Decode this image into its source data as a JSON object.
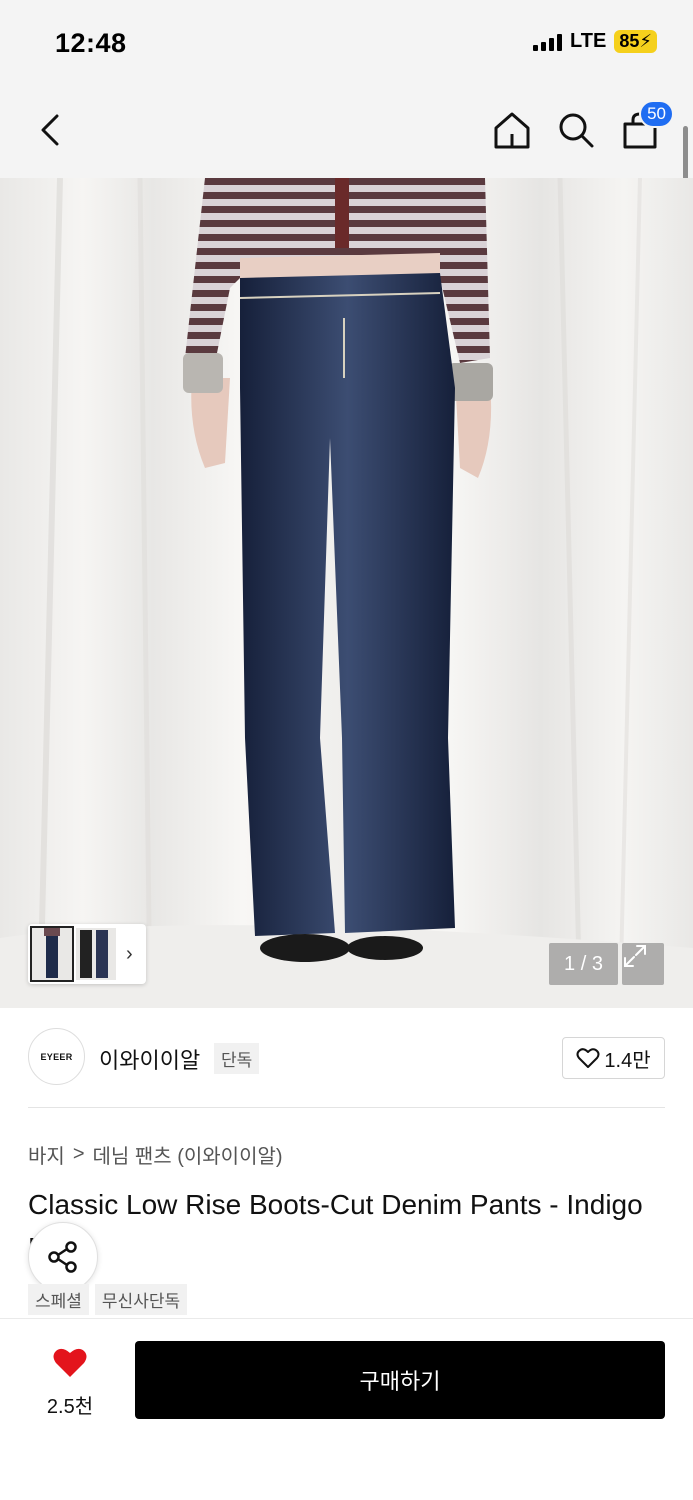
{
  "status_bar": {
    "time": "12:48",
    "network": "LTE",
    "battery": "85"
  },
  "header": {
    "cart_count": "50"
  },
  "gallery": {
    "counter": "1 / 3"
  },
  "brand": {
    "logo_text": "EYEER",
    "name": "이와이이알",
    "tag": "단독",
    "likes": "1.4만"
  },
  "breadcrumb": {
    "level1": "바지",
    "separator": ">",
    "level2": "데님 팬츠 (이와이이알)"
  },
  "product": {
    "title": "Classic Low Rise Boots-Cut Denim Pants - Indigo Blue",
    "tags": [
      "스페셜",
      "무신사단독"
    ]
  },
  "bottom": {
    "wish_count": "2.5천",
    "buy_label": "구매하기"
  },
  "colors": {
    "accent_blue": "#1f6df2",
    "heart_red": "#e3141c",
    "denim": "#1e2b4a"
  }
}
